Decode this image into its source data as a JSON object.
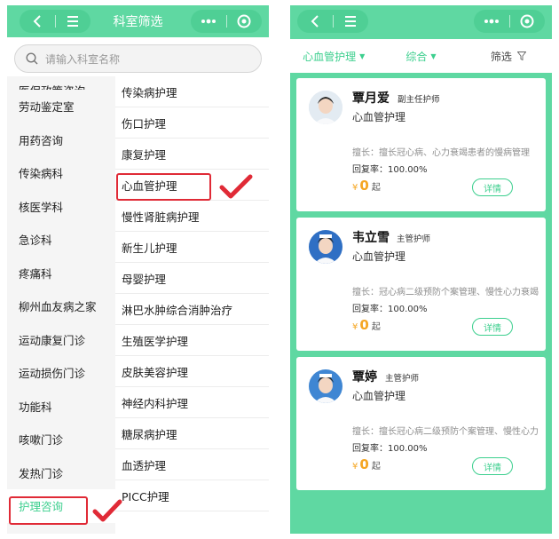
{
  "left": {
    "header_title": "科室筛选",
    "search_placeholder": "请输入科室名称",
    "sidebar_items": [
      {
        "label": "医保政策咨询"
      },
      {
        "label": "劳动鉴定室"
      },
      {
        "label": "用药咨询"
      },
      {
        "label": "传染病科"
      },
      {
        "label": "核医学科"
      },
      {
        "label": "急诊科"
      },
      {
        "label": "疼痛科"
      },
      {
        "label": "柳州血友病之家"
      },
      {
        "label": "运动康复门诊"
      },
      {
        "label": "运动损伤门诊"
      },
      {
        "label": "功能科"
      },
      {
        "label": "咳嗽门诊"
      },
      {
        "label": "发热门诊"
      },
      {
        "label": "护理咨询"
      }
    ],
    "departments": [
      {
        "label": "传染病护理"
      },
      {
        "label": "伤口护理"
      },
      {
        "label": "康复护理"
      },
      {
        "label": "心血管护理"
      },
      {
        "label": "慢性肾脏病护理"
      },
      {
        "label": "新生儿护理"
      },
      {
        "label": "母婴护理"
      },
      {
        "label": "淋巴水肿综合消肿治疗"
      },
      {
        "label": "生殖医学护理"
      },
      {
        "label": "皮肤美容护理"
      },
      {
        "label": "神经内科护理"
      },
      {
        "label": "糖尿病护理"
      },
      {
        "label": "血透护理"
      },
      {
        "label": "PICC护理"
      }
    ]
  },
  "right": {
    "filters": {
      "department": "心血管护理",
      "sort": "综合",
      "filter": "筛选"
    },
    "cards": [
      {
        "name": "覃月爱",
        "title": "副主任护师",
        "dept": "心血管护理",
        "skill": "擅长：擅长冠心病、心力衰竭患者的慢病管理",
        "rate": "回复率：100.00%",
        "price_symbol": "¥",
        "price": "0",
        "price_unit": "起",
        "button": "详情"
      },
      {
        "name": "韦立雪",
        "title": "主管护师",
        "dept": "心血管护理",
        "skill": "擅长：冠心病二级预防个案管理、慢性心力衰竭管理",
        "rate": "回复率：100.00%",
        "price_symbol": "¥",
        "price": "0",
        "price_unit": "起",
        "button": "详情"
      },
      {
        "name": "覃婷",
        "title": "主管护师",
        "dept": "心血管护理",
        "skill": "擅长：擅长冠心病二级预防个案管理、慢性心力衰竭",
        "rate": "回复率：100.00%",
        "price_symbol": "¥",
        "price": "0",
        "price_unit": "起",
        "button": "详情"
      }
    ]
  },
  "colors": {
    "brand_green": "#5fd8a2",
    "accent_green": "#3ccf8e",
    "price_orange": "#f5a623",
    "highlight_red": "#e02a36"
  }
}
